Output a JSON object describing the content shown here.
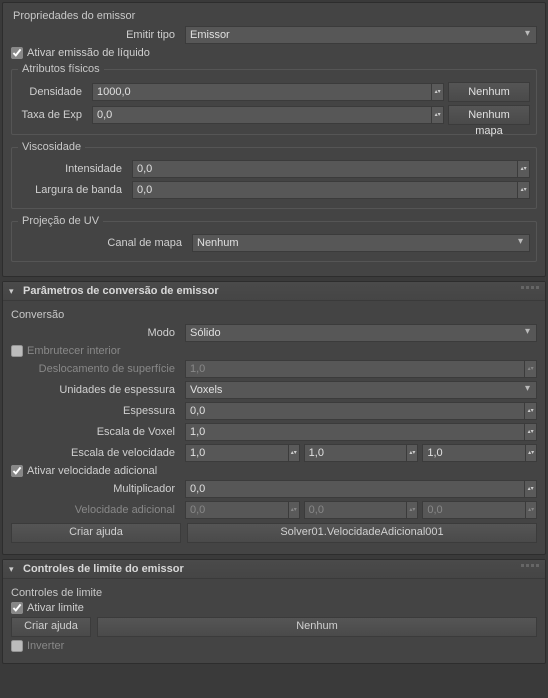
{
  "panels": {
    "emitter_props": {
      "title": "Propriedades do emissor",
      "emit_type_label": "Emitir tipo",
      "emit_type_value": "Emissor",
      "activate_liquid_emission": "Ativar emissão de líquido",
      "physical_attrs": {
        "legend": "Atributos físicos",
        "density_label": "Densidade",
        "density_value": "1000,0",
        "exp_rate_label": "Taxa de Exp",
        "exp_rate_value": "0,0",
        "no_map": "Nenhum mapa"
      },
      "viscosity": {
        "legend": "Viscosidade",
        "intensity_label": "Intensidade",
        "intensity_value": "0,0",
        "bandwidth_label": "Largura de banda",
        "bandwidth_value": "0,0"
      },
      "uv_projection": {
        "legend": "Projeção de UV",
        "map_channel_label": "Canal de mapa",
        "map_channel_value": "Nenhum"
      }
    },
    "conversion_params": {
      "title": "Parâmetros de conversão de emissor",
      "subheading": "Conversão",
      "mode_label": "Modo",
      "mode_value": "Sólido",
      "embrutecer": "Embrutecer interior",
      "surface_disp_label": "Deslocamento de superfície",
      "surface_disp_value": "1,0",
      "thickness_units_label": "Unidades de espessura",
      "thickness_units_value": "Voxels",
      "thickness_label": "Espessura",
      "thickness_value": "0,0",
      "voxel_scale_label": "Escala de Voxel",
      "voxel_scale_value": "1,0",
      "velocity_scale_label": "Escala de velocidade",
      "velocity_scale_x": "1,0",
      "velocity_scale_y": "1,0",
      "velocity_scale_z": "1,0",
      "activate_additional_velocity": "Ativar velocidade adicional",
      "multiplier_label": "Multiplicador",
      "multiplier_value": "0,0",
      "additional_velocity_label": "Velocidade adicional",
      "additional_velocity_x": "0,0",
      "additional_velocity_y": "0,0",
      "additional_velocity_z": "0,0",
      "create_help": "Criar ajuda",
      "solver_ref": "Solver01.VelocidadeAdicional001"
    },
    "emitter_limits": {
      "title": "Controles de limite do emissor",
      "subheading": "Controles de limite",
      "activate_limit": "Ativar limite",
      "create_help": "Criar ajuda",
      "none": "Nenhum",
      "invert": "Inverter"
    }
  }
}
